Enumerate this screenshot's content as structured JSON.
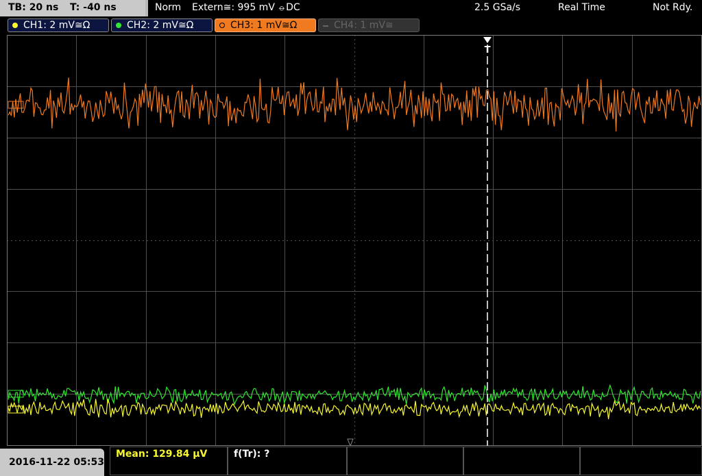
{
  "header": {
    "timebase": "TB: 20 ns",
    "trigger_time": "T: -40 ns",
    "mode": "Norm",
    "trigger_source": "Extern≅: 995 mV ⦵DC",
    "sample_rate": "2.5 GSa/s",
    "acq_mode": "Real Time",
    "state": "Not Rdy."
  },
  "channels": [
    {
      "label": "CH1: 2 mV≅Ω",
      "color": "#f8f830"
    },
    {
      "label": "CH2: 2 mV≅Ω",
      "color": "#30e830"
    },
    {
      "label": "CH3: 1 mV≅Ω",
      "color": "#f07a20"
    },
    {
      "label": "CH4: 1 mV≅",
      "color": "#666666"
    }
  ],
  "trigger_marker": "T",
  "footer": {
    "datetime": "2016-11-22 05:53",
    "mean": "Mean: 129.84 µV",
    "freq": "f(Tr): ?"
  },
  "colors": {
    "ch1": "#f8f830",
    "ch2": "#30e830",
    "ch3": "#f07a20",
    "grid": "#505050"
  }
}
